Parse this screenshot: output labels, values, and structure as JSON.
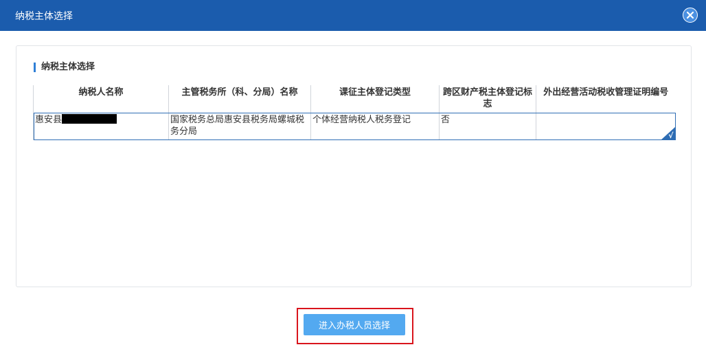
{
  "dialog": {
    "title": "纳税主体选择",
    "close_icon": "close-icon"
  },
  "section": {
    "title": "纳税主体选择"
  },
  "table": {
    "headers": [
      "纳税人名称",
      "主管税务所（科、分局）名称",
      "课征主体登记类型",
      "跨区财产税主体登记标志",
      "外出经营活动税收管理证明编号"
    ],
    "rows": [
      {
        "name_prefix": "惠安县",
        "tax_office": "国家税务总局惠安县税务局螺城税务分局",
        "registration_type": "个体经营纳税人税务登记",
        "cross_region_flag": "否",
        "cert_number": ""
      }
    ],
    "selected_mark": "√"
  },
  "footer": {
    "enter_button_label": "进入办税人员选择"
  },
  "colors": {
    "titlebar": "#1b5cad",
    "button": "#53a9f0",
    "highlight_border": "#d9141c",
    "row_selected_border": "#2e6db4"
  }
}
